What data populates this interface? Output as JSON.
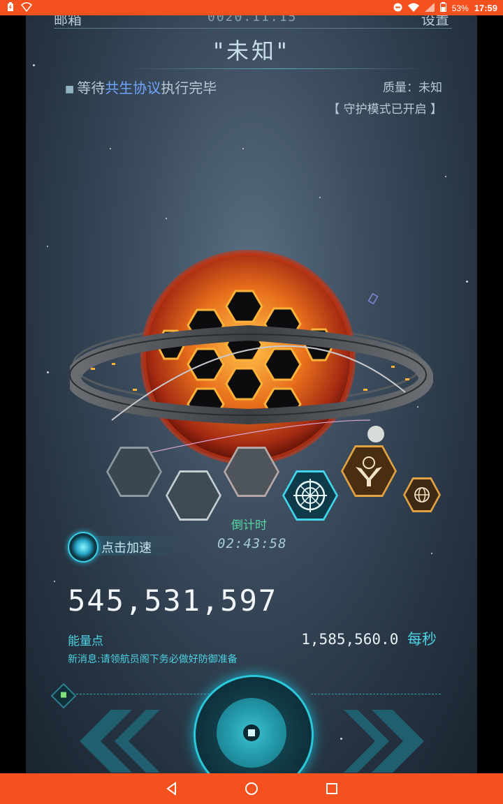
{
  "status_bar": {
    "battery": "53%",
    "time": "17:59"
  },
  "header": {
    "mail_label": "邮箱",
    "date": "0020.11.15",
    "settings_label": "设置",
    "title": "\"未知\""
  },
  "status": {
    "waiting_prefix": "等待",
    "protocol": "共生协议",
    "waiting_suffix": "执行完毕",
    "quality": "质量：未知",
    "guard_mode": "【 守护模式已开启 】"
  },
  "countdown": {
    "label": "倒计时",
    "value": "02:43:58"
  },
  "accelerate": {
    "label": "点击加速"
  },
  "energy": {
    "total": "545,531,597",
    "label": "能量点",
    "rate": "1,585,560.0",
    "rate_unit": "每秒"
  },
  "news": "新消息:请领航员阁下务必做好防御准备",
  "colors": {
    "status_bar": "#f4511e",
    "accent_cyan": "#4ed1e2",
    "accent_green": "#57d6a0",
    "protocol_blue": "#6fa5ff"
  },
  "icons": {
    "hex_selected": "compass-icon",
    "hex_gold": "eagle-emblem-icon",
    "hex_small_gold": "globe-icon"
  }
}
